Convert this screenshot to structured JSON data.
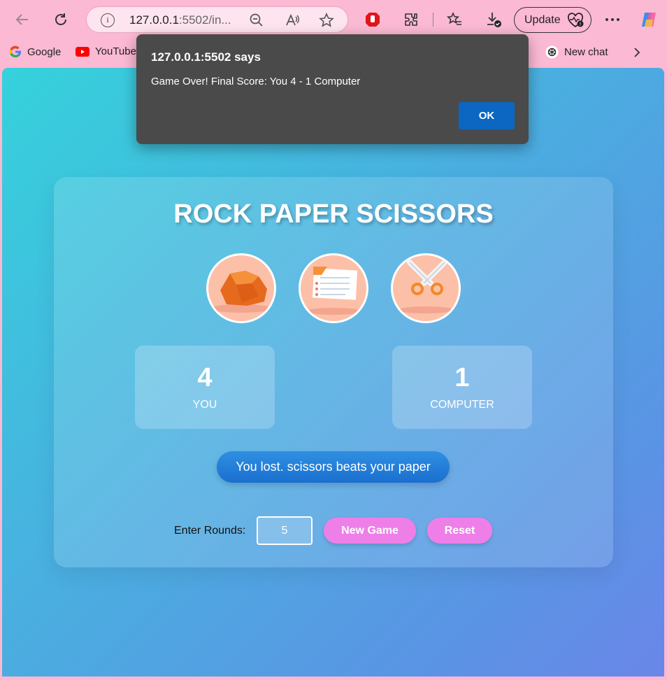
{
  "browser": {
    "url_host": "127.0.0.1",
    "url_rest": ":5502/in...",
    "update_label": "Update",
    "bookmarks": [
      {
        "label": "Google"
      },
      {
        "label": "YouTube"
      },
      {
        "label": "New chat"
      }
    ]
  },
  "dialog": {
    "title": "127.0.0.1:5502 says",
    "message": "Game Over! Final Score: You 4 - 1 Computer",
    "ok_label": "OK"
  },
  "game": {
    "title": "ROCK PAPER SCISSORS",
    "choices": [
      "rock",
      "paper",
      "scissors"
    ],
    "player": {
      "score": "4",
      "label": "YOU"
    },
    "computer": {
      "score": "1",
      "label": "COMPUTER"
    },
    "result": "You lost. scissors beats your paper",
    "rounds_label": "Enter Rounds:",
    "rounds_value": "5",
    "new_game_label": "New Game",
    "reset_label": "Reset"
  },
  "colors": {
    "accent_button": "#ee7fe8",
    "result_bg": "#1a6fcf",
    "dialog_ok": "#0b67c2"
  }
}
